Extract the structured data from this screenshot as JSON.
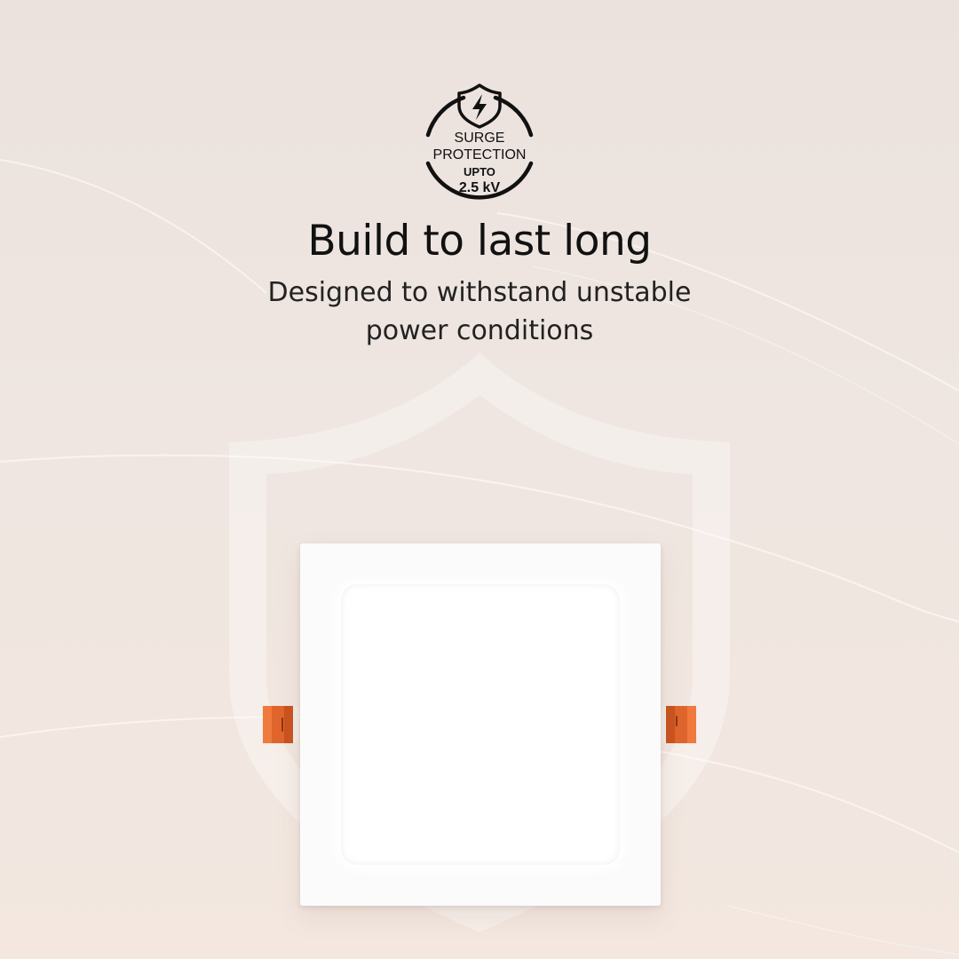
{
  "badge": {
    "line1": "SURGE",
    "line2": "PROTECTION",
    "line3": "UPTO",
    "line4": "2.5 kV",
    "icon": "shield-lightning-icon"
  },
  "headline": "Build to last long",
  "subline": {
    "line1": "Designed to withstand unstable",
    "line2": "power conditions"
  },
  "colors": {
    "background": "#ede3de",
    "text": "#141414",
    "clip": "#e2672e",
    "panel": "#fbfbfb"
  }
}
